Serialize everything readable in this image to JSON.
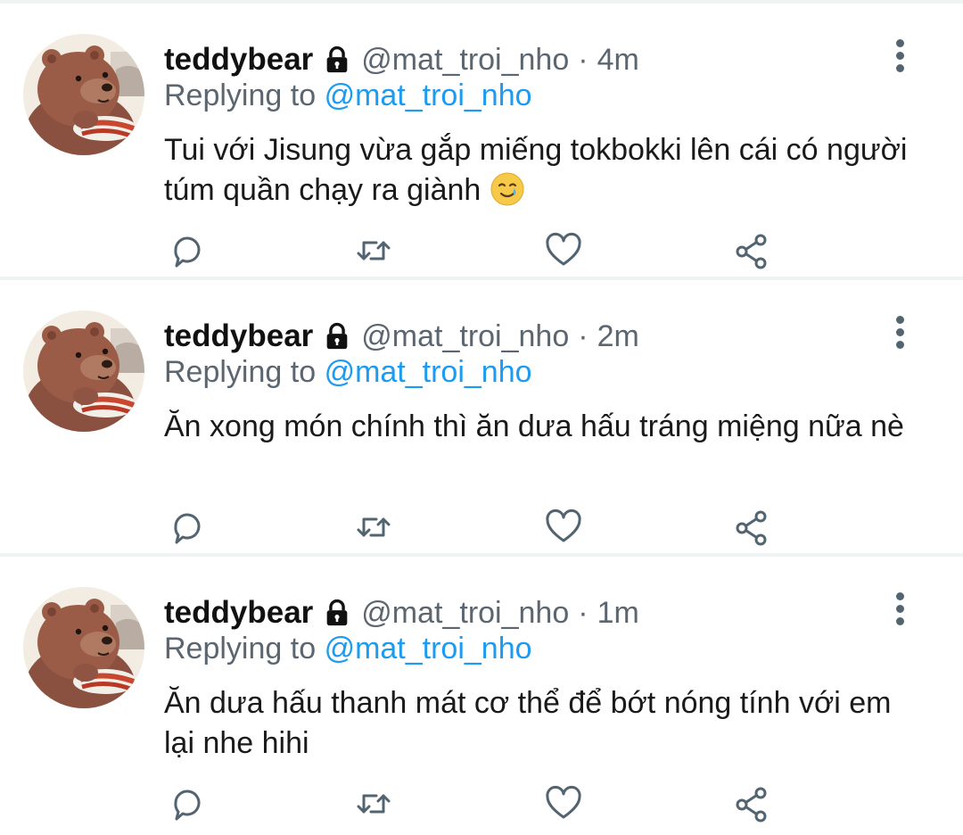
{
  "colors": {
    "text": "#0f1419",
    "muted": "#5b6670",
    "accent": "#1d9bf0",
    "icon": "#536471",
    "divider": "#eff3f4"
  },
  "tweets": [
    {
      "name": "teddybear",
      "handle": "@mat_troi_nho",
      "separator": "·",
      "time": "4m",
      "replying_prefix": "Replying to",
      "replying_to": "@mat_troi_nho",
      "text": "Tui với Jisung vừa gắp miếng tokbokki lên cái có người túm quần chạy ra giành",
      "emoji": "smiling-face-with-tear",
      "icons": [
        "lock-icon",
        "more-options-icon",
        "reply-icon",
        "retweet-icon",
        "like-icon",
        "share-icon"
      ]
    },
    {
      "name": "teddybear",
      "handle": "@mat_troi_nho",
      "separator": "·",
      "time": "2m",
      "replying_prefix": "Replying to",
      "replying_to": "@mat_troi_nho",
      "text": "Ăn xong món chính thì ăn dưa hấu tráng miệng nữa nè",
      "icons": [
        "lock-icon",
        "more-options-icon",
        "reply-icon",
        "retweet-icon",
        "like-icon",
        "share-icon"
      ]
    },
    {
      "name": "teddybear",
      "handle": "@mat_troi_nho",
      "separator": "·",
      "time": "1m",
      "replying_prefix": "Replying to",
      "replying_to": "@mat_troi_nho",
      "text": "Ăn dưa hấu thanh mát cơ thể để bớt nóng tính với em lại nhe hihi",
      "icons": [
        "lock-icon",
        "more-options-icon",
        "reply-icon",
        "retweet-icon",
        "like-icon",
        "share-icon"
      ]
    }
  ]
}
